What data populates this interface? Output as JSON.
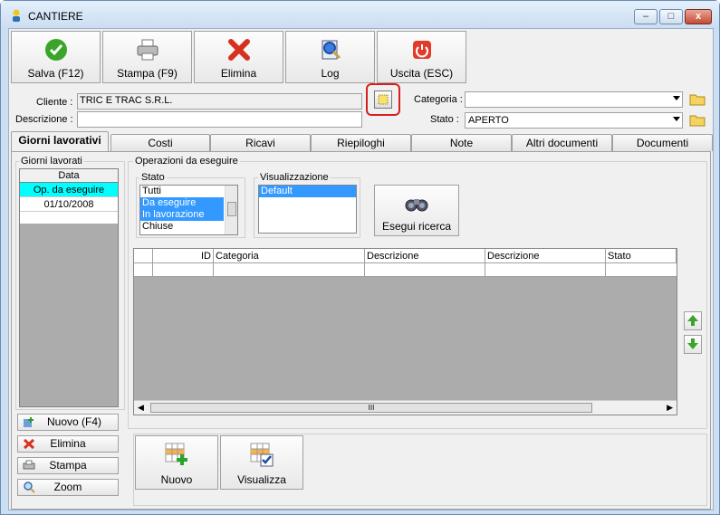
{
  "window": {
    "title": "CANTIERE",
    "min_label": "–",
    "max_label": "□",
    "close_label": "x"
  },
  "toolbar": {
    "save": "Salva (F12)",
    "print": "Stampa (F9)",
    "delete": "Elimina",
    "log": "Log",
    "exit": "Uscita (ESC)"
  },
  "form": {
    "cliente_label": "Cliente :",
    "cliente_value": "TRIC E TRAC S.R.L.",
    "descrizione_label": "Descrizione :",
    "descrizione_value": "",
    "categoria_label": "Categoria :",
    "categoria_value": "",
    "stato_label": "Stato :",
    "stato_value": "APERTO"
  },
  "tabs": [
    "Giorni lavorativi",
    "Costi",
    "Ricavi",
    "Riepiloghi",
    "Note",
    "Altri documenti",
    "Documenti"
  ],
  "giorni": {
    "title": "Giorni lavorati",
    "header": "Data",
    "rows": [
      "Op. da eseguire",
      "01/10/2008"
    ],
    "buttons": {
      "nuovo": "Nuovo (F4)",
      "elimina": "Elimina",
      "stampa": "Stampa",
      "zoom": "Zoom"
    }
  },
  "operazioni": {
    "title": "Operazioni da eseguire",
    "stato_title": "Stato",
    "stato_items": [
      "Tutti",
      "Da eseguire",
      "In lavorazione",
      "Chiuse"
    ],
    "vis_title": "Visualizzazione",
    "vis_items": [
      "Default"
    ],
    "search_button": "Esegui ricerca",
    "columns": [
      "ID",
      "Categoria",
      "Descrizione",
      "Descrizione",
      "Stato"
    ],
    "scroll_thumb": "III",
    "nuovo": "Nuovo",
    "visualizza": "Visualizza"
  }
}
